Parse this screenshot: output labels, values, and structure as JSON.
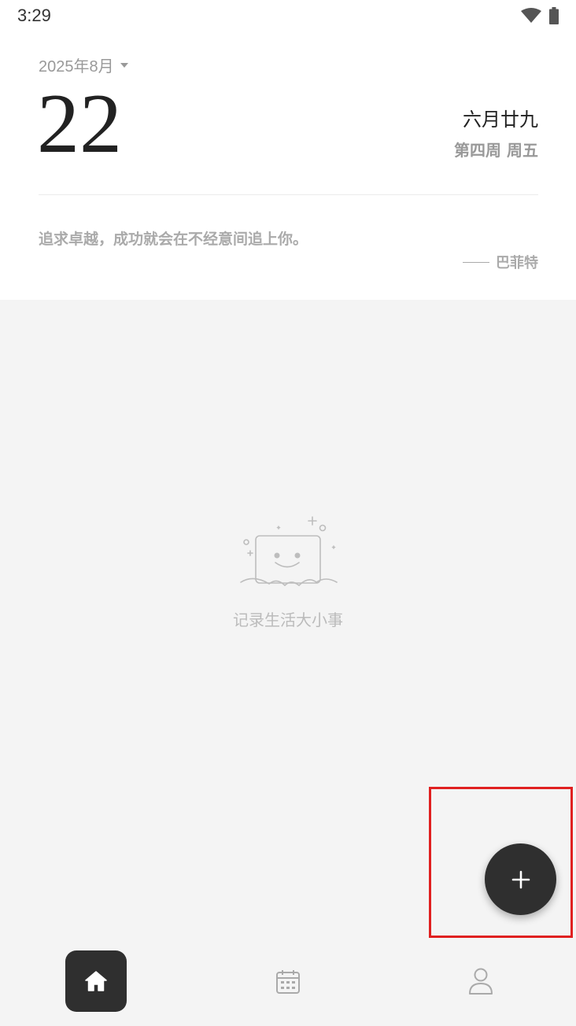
{
  "status_bar": {
    "time": "3:29",
    "icons": [
      "wifi-icon",
      "battery-icon"
    ]
  },
  "header": {
    "month_label": "2025年8月",
    "day": "22",
    "lunar_date": "六月廿九",
    "week_info": "第四周 周五",
    "quote": "追求卓越，成功就会在不经意间追上你。",
    "author": "巴菲特"
  },
  "empty_state": {
    "text": "记录生活大小事",
    "icon": "smiling-notebook-illustration"
  },
  "fab": {
    "icon": "plus-icon"
  },
  "bottom_nav": {
    "items": [
      {
        "name": "home",
        "icon": "home-icon",
        "active": true
      },
      {
        "name": "calendar",
        "icon": "calendar-icon",
        "active": false
      },
      {
        "name": "profile",
        "icon": "user-icon",
        "active": false
      }
    ]
  },
  "colors": {
    "accent": "#2f2f2f",
    "background": "#f4f4f4",
    "highlight": "#e02020"
  }
}
